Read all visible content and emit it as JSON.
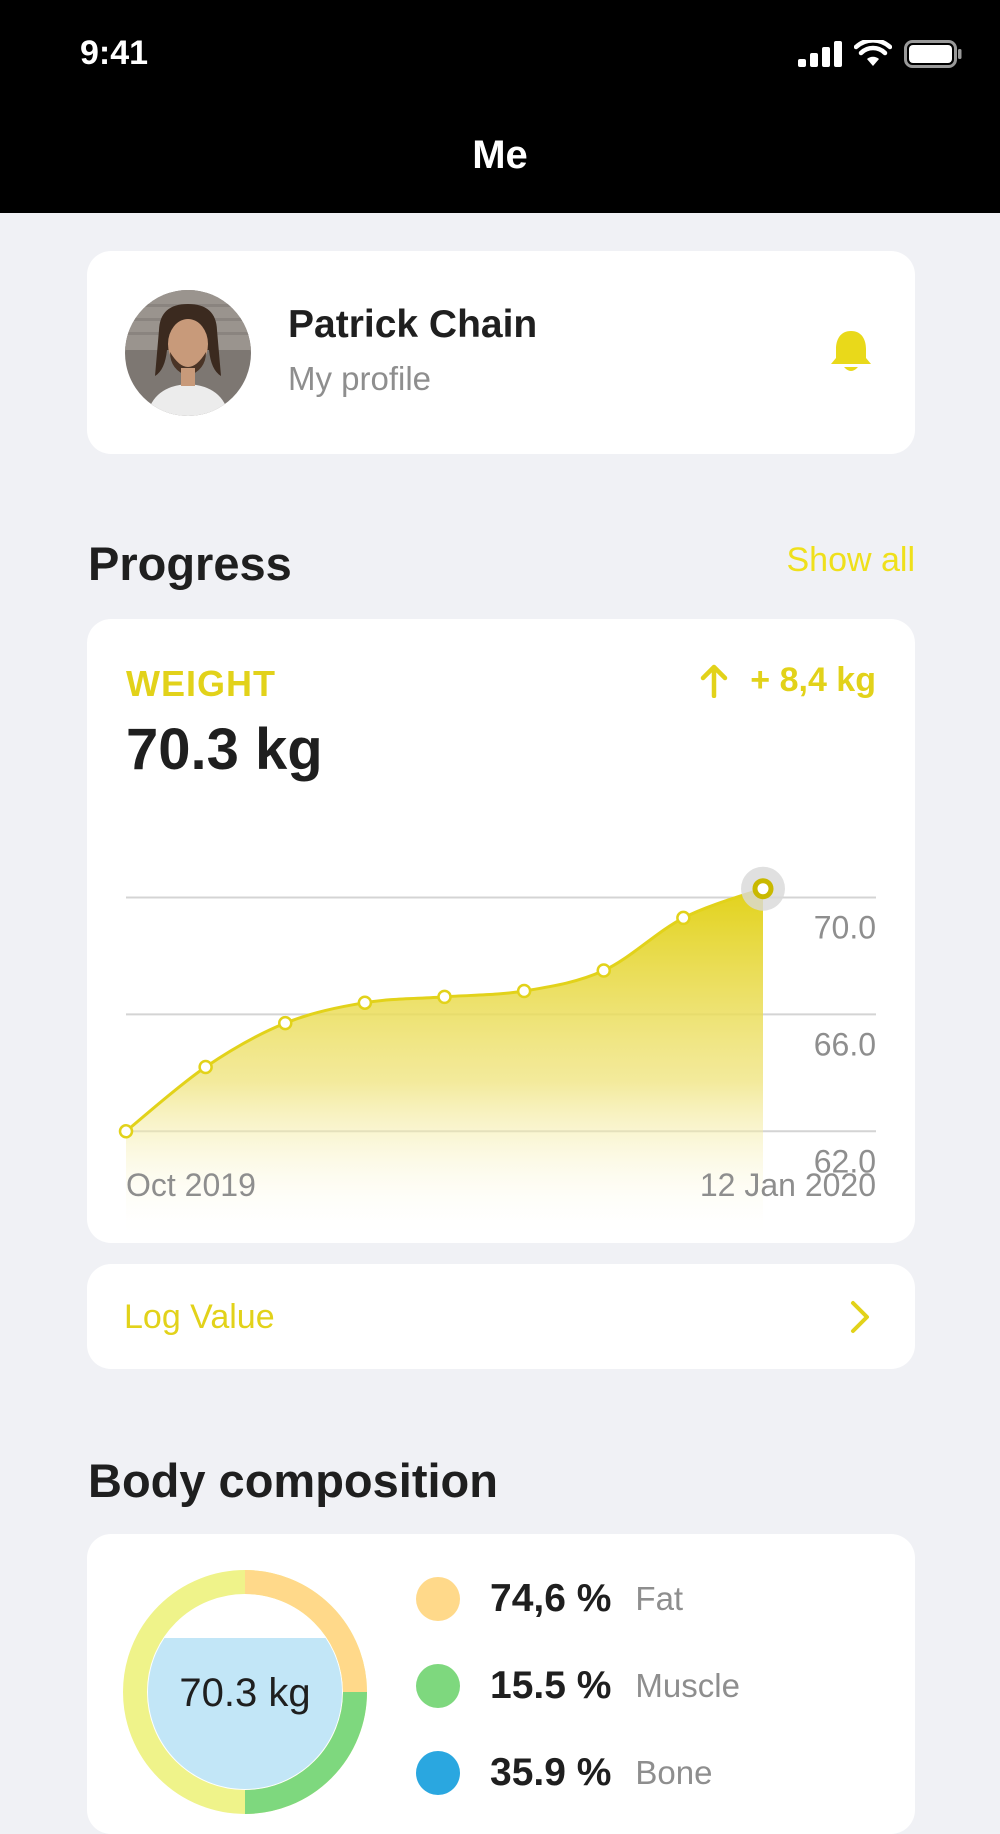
{
  "status_bar": {
    "time": "9:41"
  },
  "nav": {
    "title": "Me"
  },
  "profile": {
    "name": "Patrick Chain",
    "subtitle": "My profile"
  },
  "progress": {
    "title": "Progress",
    "show_all": "Show all",
    "metric": {
      "label": "WEIGHT",
      "value": "70.3 kg",
      "change": "+ 8,4 kg"
    },
    "start_date": "Oct 2019",
    "end_date": "12 Jan 2020"
  },
  "log": {
    "label": "Log Value"
  },
  "body": {
    "title": "Body composition",
    "total": "70.3 kg",
    "items": [
      {
        "pct": "74,6 %",
        "name": "Fat",
        "color": "#FFD98A"
      },
      {
        "pct": "15.5 %",
        "name": "Muscle",
        "color": "#7ED87E"
      },
      {
        "pct": "35.9 %",
        "name": "Bone",
        "color": "#2AA7E0"
      }
    ]
  },
  "colors": {
    "accent": "#E2D21A",
    "background": "#F0F1F5"
  },
  "chart_data": {
    "type": "area",
    "ylim": [
      59,
      72
    ],
    "yticks": [
      "70.0",
      "66.0",
      "62.0"
    ],
    "ytick_values": [
      70,
      66,
      62
    ],
    "y": [
      62.0,
      64.2,
      65.7,
      66.4,
      66.6,
      66.8,
      67.5,
      69.3,
      70.3
    ],
    "grid": true
  }
}
